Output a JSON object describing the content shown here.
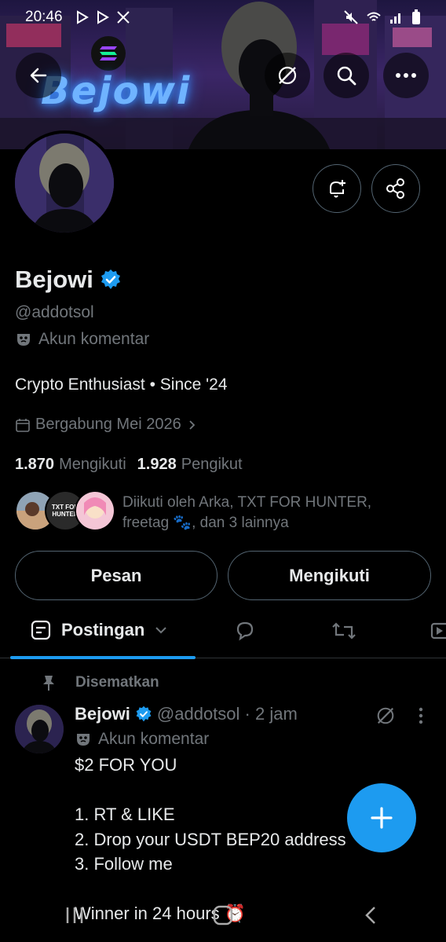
{
  "status_bar": {
    "time": "20:46",
    "left_icons": [
      "play-store-icon",
      "play-store-icon",
      "x-logo-icon"
    ],
    "right_icons": [
      "mute-icon",
      "wifi-icon",
      "signal-icon",
      "battery-icon"
    ]
  },
  "banner": {
    "text": "Bejowi",
    "logo": "solana-logo-icon"
  },
  "top_actions": {
    "back": "back-arrow-icon",
    "grok": "grok-icon",
    "search": "search-icon",
    "more": "more-icon"
  },
  "profile": {
    "name": "Bejowi",
    "verified": true,
    "handle": "@addotsol",
    "comment_label": "Akun komentar",
    "bio": "Crypto Enthusiast • Since '24",
    "joined": "Bergabung Mei 2026",
    "following_count": "1.870",
    "following_label": "Mengikuti",
    "followers_count": "1.928",
    "followers_label": "Pengikut",
    "followed_by_text": "Diikuti oleh Arka, TXT FOR HUNTER, freetag 🐾, dan 3 lainnya",
    "followed_by_avatar2_text": "TXT FOR HUNTER"
  },
  "buttons": {
    "message": "Pesan",
    "following": "Mengikuti"
  },
  "tabs": {
    "posts_label": "Postingan"
  },
  "pinned_post": {
    "pinned_label": "Disematkan",
    "author": "Bejowi",
    "handle_time": "@addotsol · 2 jam",
    "comment_label": "Akun komentar",
    "body": "$2 FOR YOU\n\n1. RT & LIKE\n2. Drop your USDT BEP20 address\n3. Follow me\n\nWinner in 24 hours ⏰"
  },
  "colors": {
    "accent": "#1d9bf0",
    "background": "#000000",
    "text_primary": "#e7e9ea",
    "text_secondary": "#71767b"
  }
}
